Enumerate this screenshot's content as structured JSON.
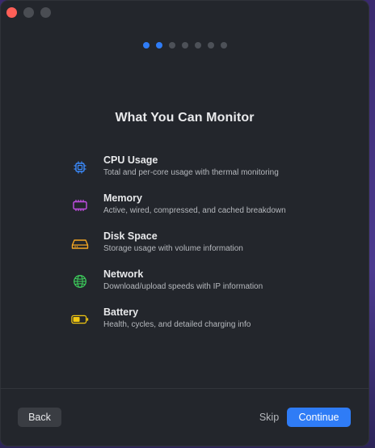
{
  "window": {
    "controls": [
      "close",
      "minimize",
      "maximize"
    ]
  },
  "pager": {
    "total": 7,
    "active": [
      0,
      1
    ],
    "active_color": "#2f7cf6"
  },
  "title": "What You Can Monitor",
  "features": [
    {
      "name": "CPU Usage",
      "desc": "Total and per-core usage with thermal monitoring",
      "icon": "cpu-chip-icon",
      "color": "#3b8cff"
    },
    {
      "name": "Memory",
      "desc": "Active, wired, compressed, and cached breakdown",
      "icon": "memory-chip-icon",
      "color": "#c44fe6"
    },
    {
      "name": "Disk Space",
      "desc": "Storage usage with volume information",
      "icon": "hard-drive-icon",
      "color": "#f5a623"
    },
    {
      "name": "Network",
      "desc": "Download/upload speeds with IP information",
      "icon": "globe-icon",
      "color": "#3cc85a"
    },
    {
      "name": "Battery",
      "desc": "Health, cycles, and detailed charging info",
      "icon": "battery-icon",
      "color": "#f2c811"
    }
  ],
  "footer": {
    "back_label": "Back",
    "skip_label": "Skip",
    "continue_label": "Continue"
  }
}
